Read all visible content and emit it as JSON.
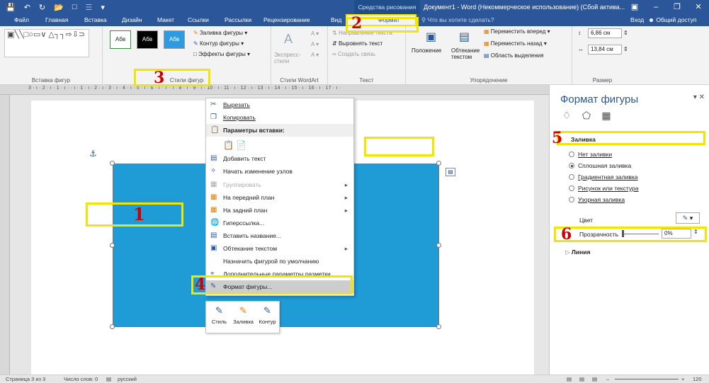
{
  "titlebar": {
    "context_group": "Средства рисования",
    "doc_title": "Документ1 - Word (Некоммерческое использование) (Сбой актива...",
    "qat_icons": [
      "save-icon",
      "undo-icon",
      "redo-icon",
      "folder-icon",
      "new-doc-icon",
      "layout-icon",
      "customize-icon"
    ]
  },
  "tabs": [
    "Файл",
    "Главная",
    "Вставка",
    "Дизайн",
    "Макет",
    "Ссылки",
    "Рассылки",
    "Рецензирование",
    "Вид"
  ],
  "active_tab": "Формат",
  "tell_me": "Что вы хотите сделать?",
  "signin": "Вход",
  "share": "Общий доступ",
  "ribbon": {
    "insert_shapes": {
      "label": "Вставка фигур",
      "shapes": "▣╲╲□○▭∨ △┐┐⇨⇩⊃ ↯⌒⌒{}☆♀"
    },
    "shape_styles": {
      "label": "Стили фигур",
      "presets": [
        "Абв",
        "Абв",
        "Абв"
      ],
      "fill": "Заливка фигуры",
      "outline": "Контур фигуры",
      "effects": "Эффекты фигуры"
    },
    "wordart": {
      "label": "Стили WordArt",
      "express": "Экспресс-стили",
      "letter": "A"
    },
    "text": {
      "label": "Текст",
      "direction": "Направление текста",
      "align": "Выровнять текст",
      "link": "Создать связь"
    },
    "arrange": {
      "label": "Упорядочение",
      "position": "Положение",
      "wrap": "Обтекание текстом",
      "forward": "Переместить вперед",
      "backward": "Переместить назад",
      "selection": "Область выделения"
    },
    "size": {
      "label": "Размер",
      "height": "6,86 см",
      "width": "13,84 см"
    }
  },
  "ruler_scale": "3 · ı · 2 · ı · 1 · ı ·     · ı · 1 · ı · 2 · ı · 3 · ı · 4 · ı · 5 · ı · 6 · ı · 7 · ı · 8 · ı · 9 · ı · 10 · ı · 11 · ı · 12 · ı · 13 · ı · 14 · ı · 15 · ı · 16 · ı · 17 · ı ·",
  "context_menu": {
    "items": [
      {
        "label": "Вырезать",
        "icon": "cut-icon"
      },
      {
        "label": "Копировать",
        "icon": "copy-icon"
      },
      {
        "label": "Параметры вставки:",
        "icon": "paste-icon"
      },
      {
        "label": "",
        "icon": "paste-option-icon"
      },
      {
        "label": "Добавить текст",
        "icon": "add-text-icon"
      },
      {
        "label": "Начать изменение узлов",
        "icon": "edit-points-icon"
      },
      {
        "label": "Группировать",
        "icon": "group-icon"
      },
      {
        "label": "На передний план",
        "icon": "bring-front-icon"
      },
      {
        "label": "На задний план",
        "icon": "send-back-icon"
      },
      {
        "label": "Гиперссылка...",
        "icon": "hyperlink-icon"
      },
      {
        "label": "Вставить название...",
        "icon": "caption-icon"
      },
      {
        "label": "Обтекание текстом",
        "icon": "wrap-icon"
      },
      {
        "label": "Назначить фигурой по умолчанию",
        "icon": ""
      },
      {
        "label": "Дополнительные параметры разметки...",
        "icon": "layout-options-icon"
      },
      {
        "label": "Формат фигуры...",
        "icon": "format-shape-icon"
      }
    ]
  },
  "mini_toolbar": [
    "Стиль",
    "Заливка",
    "Контур"
  ],
  "pane": {
    "title": "Формат фигуры",
    "fill_section": "Заливка",
    "options": [
      "Нет заливки",
      "Сплошная заливка",
      "Градиентная заливка",
      "Рисунок или текстура",
      "Узорная заливка"
    ],
    "selected": "Сплошная заливка",
    "color_label": "Цвет",
    "transparency_label": "Прозрачность",
    "transparency_value": "0%",
    "line_section": "Линия",
    "fill_color": "#1f9cd6"
  },
  "annotations": [
    "1",
    "2",
    "3",
    "4",
    "5",
    "6"
  ],
  "status": {
    "page": "Страница 3 из 3",
    "words": "Число слов: 0",
    "lang": "русский",
    "zoom": "120"
  }
}
